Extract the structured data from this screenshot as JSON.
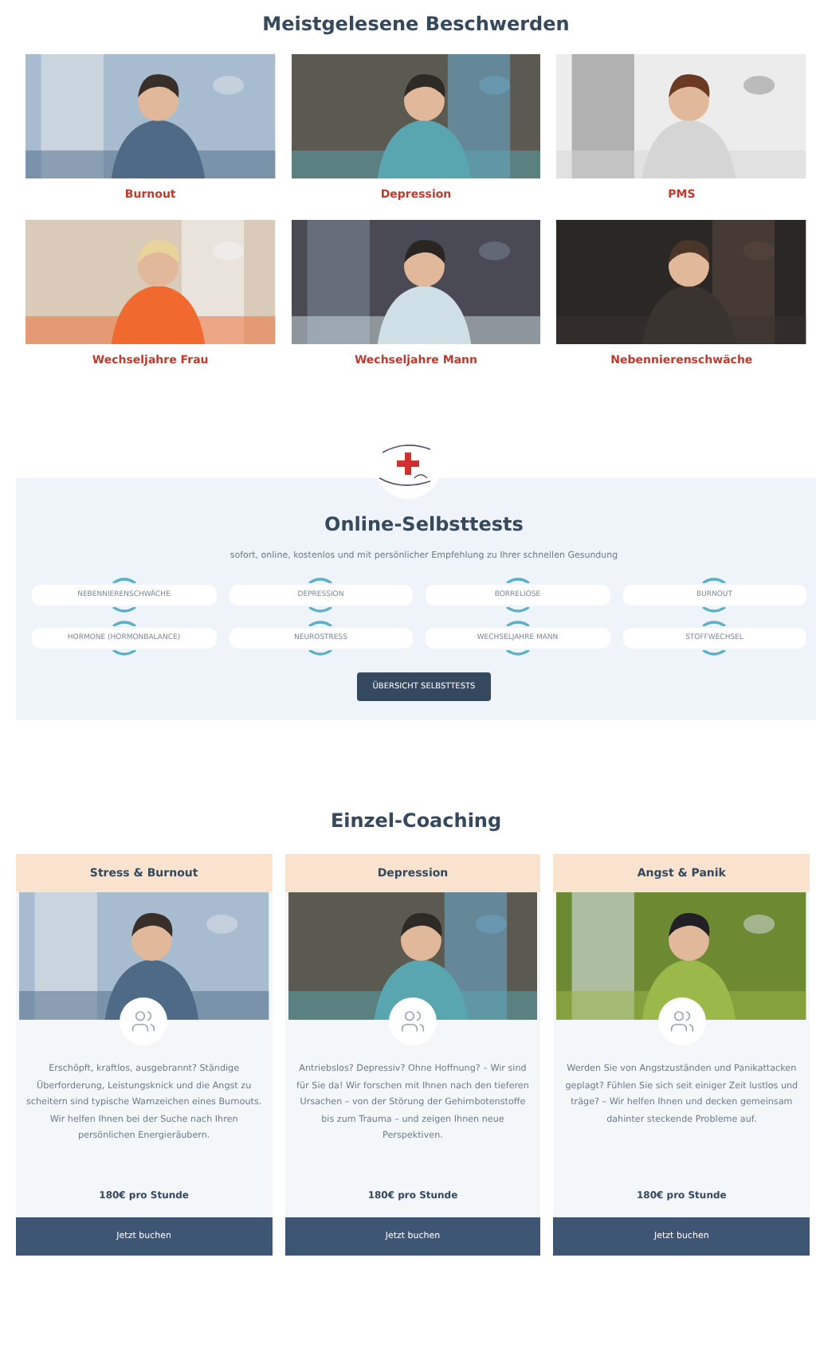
{
  "complaints": {
    "title": "Meistgelesene Beschwerden",
    "items": [
      {
        "label": "Burnout",
        "kind": "picture"
      },
      {
        "label": "Depression",
        "kind": "picture"
      },
      {
        "label": "PMS",
        "kind": "picture"
      },
      {
        "label": "Wechseljahre Frau",
        "kind": "picture"
      },
      {
        "label": "Wechseljahre Mann",
        "kind": "picture"
      },
      {
        "label": "Nebennierenschwäche",
        "kind": "picture"
      }
    ]
  },
  "selftests": {
    "title": "Online-Selbsttests",
    "subtitle": "sofort, online, kostenlos und mit persönlicher Empfehlung zu Ihrer schnellen Gesundung",
    "tests": [
      "NEBENNIERENSCHWÄCHE",
      "DEPRESSION",
      "BORRELIOSE",
      "BURNOUT",
      "HORMONE (HORMONBALANCE)",
      "NEUROSTRESS",
      "WECHSELJAHRE MANN",
      "STOFFWECHSEL"
    ],
    "button": "ÜBERSICHT SELBSTTESTS"
  },
  "coaching": {
    "title": "Einzel-Coaching",
    "cards": [
      {
        "title": "Stress & Burnout",
        "kind": "picture",
        "text": "Erschöpft, kraftlos, ausgebrannt? Ständige Überforderung, Leistungsknick und die Angst zu scheitern sind typische Warnzeichen eines Burnouts. Wir helfen Ihnen bei der Suche nach Ihren persönlichen Energieräubern.",
        "price": "180€ pro Stunde",
        "button": "Jetzt buchen"
      },
      {
        "title": "Depression",
        "kind": "picture",
        "text": "Antriebslos? Depressiv? Ohne Hoffnung? – Wir sind für Sie da! Wir forschen mit Ihnen nach den tieferen Ursachen – von der Störung der Gehirnbotenstoffe bis zum Trauma – und zeigen Ihnen neue Perspektiven.",
        "price": "180€ pro Stunde",
        "button": "Jetzt buchen"
      },
      {
        "title": "Angst & Panik",
        "kind": "picture",
        "text": "Werden Sie von Angstzuständen und Panikattacken geplagt? Fühlen Sie sich seit einiger Zeit lustlos und träge? – Wir helfen Ihnen und decken gemeinsam dahinter steckende Probleme auf.",
        "price": "180€ pro Stunde",
        "button": "Jetzt buchen"
      }
    ]
  }
}
